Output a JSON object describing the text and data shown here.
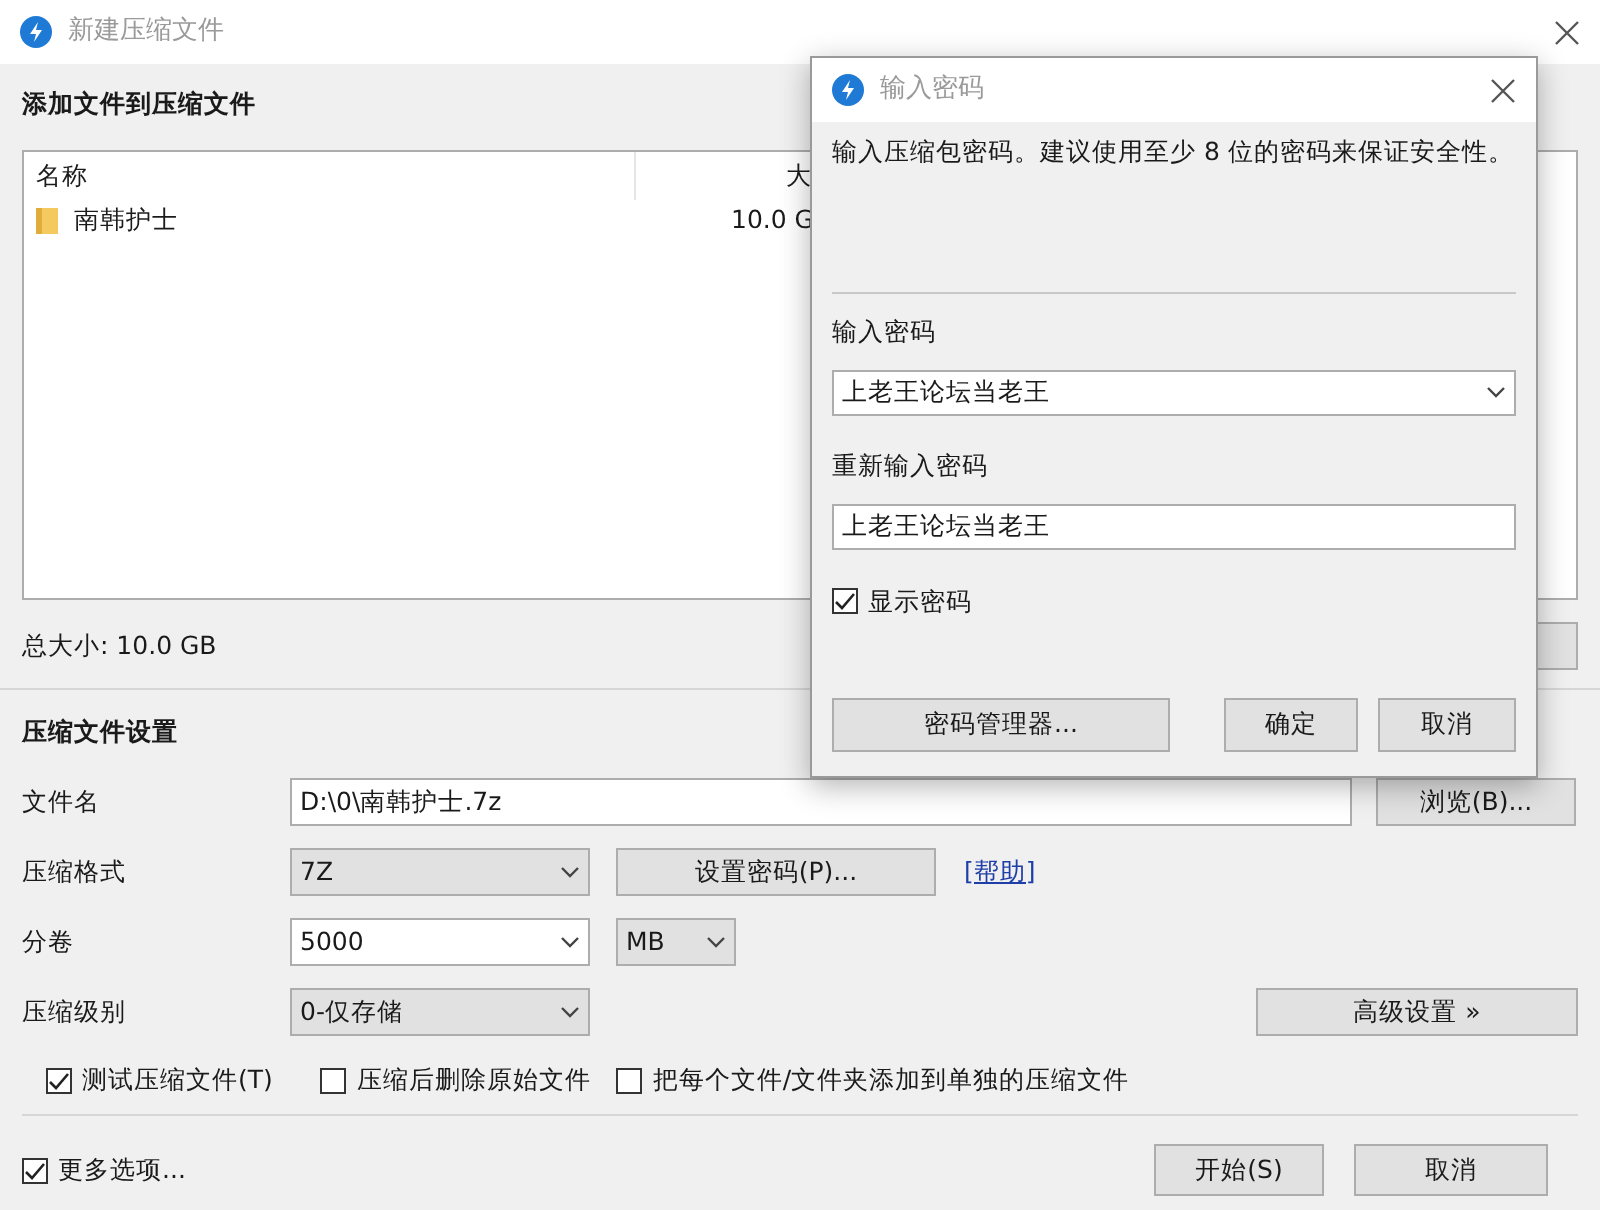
{
  "main_window": {
    "title": "新建压缩文件",
    "files": {
      "heading": "添加文件到压缩文件",
      "columns": [
        "名称",
        "大"
      ],
      "rows": [
        {
          "kind": "folder",
          "name": "南韩护士",
          "size": "10.0 G"
        }
      ],
      "total": "总大小: 10.0 GB"
    },
    "settings": {
      "heading": "压缩文件设置",
      "rows": [
        {
          "label": "文件名",
          "controls": [
            {
              "kind": "text",
              "value": "D:\\0\\南韩护士.7z"
            },
            {
              "kind": "button",
              "label": "浏览(B)..."
            }
          ]
        },
        {
          "label": "压缩格式",
          "controls": [
            {
              "kind": "select",
              "value": "7Z"
            },
            {
              "kind": "button",
              "label": "设置密码(P)..."
            },
            {
              "kind": "link",
              "label": "[帮助]"
            }
          ]
        },
        {
          "label": "分卷",
          "controls": [
            {
              "kind": "combo",
              "value": "5000"
            },
            {
              "kind": "select",
              "value": "MB"
            }
          ]
        },
        {
          "label": "压缩级别",
          "controls": [
            {
              "kind": "select",
              "value": "0-仅存储"
            },
            {
              "kind": "button",
              "label": "高级设置 »"
            }
          ]
        }
      ],
      "options": [
        {
          "label": "测试压缩文件(T)",
          "checked": true
        },
        {
          "label": "压缩后删除原始文件",
          "checked": false
        },
        {
          "label": "把每个文件/文件夹添加到单独的压缩文件",
          "checked": false
        }
      ]
    },
    "more_options": {
      "label": "更多选项...",
      "checked": true
    },
    "buttons": [
      "开始(S)",
      "取消"
    ]
  },
  "password_dialog": {
    "title": "输入密码",
    "message": "输入压缩包密码。建议使用至少 8 位的密码来保证安全性。",
    "password_label": "输入密码",
    "password": "上老王论坛当老王",
    "confirm_label": "重新输入密码",
    "confirm": "上老王论坛当老王",
    "show_password": {
      "label": "显示密码",
      "checked": true
    },
    "buttons": [
      "密码管理器...",
      "确定",
      "取消"
    ]
  }
}
